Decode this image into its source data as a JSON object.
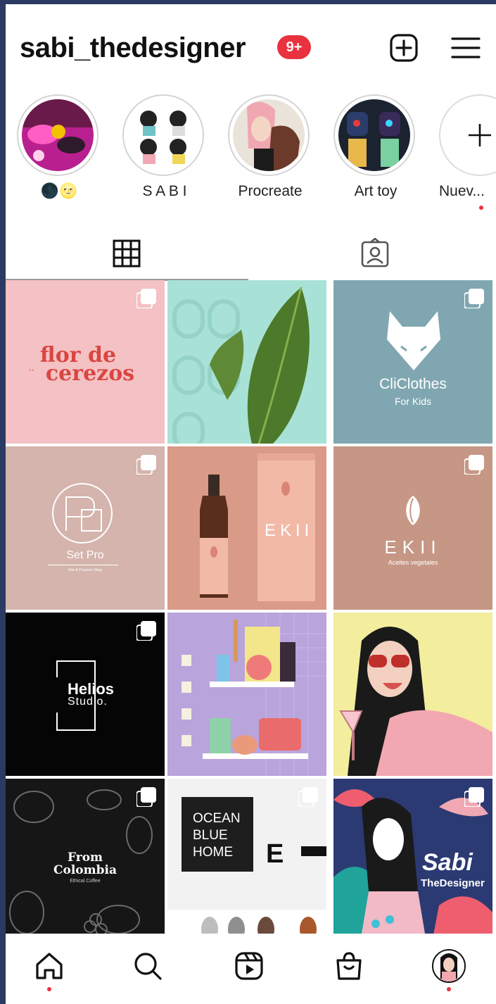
{
  "header": {
    "username": "sabi_thedesigner",
    "notification_badge": "9+",
    "icons": [
      "new-post-icon",
      "menu-icon"
    ]
  },
  "stories": [
    {
      "label": "🌑🌝",
      "thumb": "purple-art"
    },
    {
      "label": "S A B I",
      "thumb": "sketch-figures"
    },
    {
      "label": "Procreate",
      "thumb": "pink-hair-girl"
    },
    {
      "label": "Art toy",
      "thumb": "art-toy-figures"
    },
    {
      "label": "Nuev...",
      "thumb": "new-story-plus",
      "new_indicator": true
    }
  ],
  "tabs": {
    "active": "grid",
    "items": [
      "grid-icon",
      "tagged-icon"
    ]
  },
  "grid": {
    "posts": [
      {
        "name": "post-flor-de-cerezos",
        "line1": "flor de",
        "line2": "cerezos",
        "small": "• •",
        "bg": "#f4c1c4",
        "fg": "#d94641",
        "multi": true
      },
      {
        "name": "post-plant-leaf",
        "bg": "#a8e2d6",
        "multi": false
      },
      {
        "name": "post-cliclothes",
        "line1": "CliClothes",
        "line2": "For Kids",
        "bg": "#80a7b1",
        "fg": "#ffffff",
        "multi": true
      },
      {
        "name": "post-set-pro",
        "line1": "Set Pro",
        "line2": "Hair & Products Shop",
        "bg": "#d4b4ad",
        "fg": "#ffffff",
        "multi": true
      },
      {
        "name": "post-ekii-bottle",
        "line1": "EKII",
        "bg": "#d99a87",
        "fg": "#ffffff",
        "multi": false
      },
      {
        "name": "post-ekii-logo",
        "line1": "EKII",
        "line2": "Aceites vegetales",
        "bg": "#c69785",
        "fg": "#ffffff",
        "multi": true
      },
      {
        "name": "post-helios-studio",
        "line1": "Helios",
        "line2": "Studio.",
        "bg": "#050505",
        "fg": "#ffffff",
        "multi": true
      },
      {
        "name": "post-shelf-illustration",
        "bg": "#b9a4dc",
        "multi": false
      },
      {
        "name": "post-girl-drink",
        "bg": "#f3ed9e",
        "multi": false
      },
      {
        "name": "post-from-colombia",
        "line1": "From",
        "line2": "Colombia",
        "small": "Ethical Coffee",
        "bg": "#161616",
        "fg": "#ffffff",
        "multi": true
      },
      {
        "name": "post-ocean-blue-home",
        "line1": "OCEAN",
        "line2": "BLUE",
        "line3": "HOME",
        "mark": "E",
        "bg": "#f2f2f2",
        "fg": "#ffffff",
        "multi": true
      },
      {
        "name": "post-sabi-thedesigner",
        "line1": "Sabi",
        "line2": "TheDesigner",
        "bg": "#2b3a73",
        "fg": "#ffffff",
        "multi": true
      }
    ]
  },
  "bottom_nav": {
    "items": [
      "home-icon",
      "search-icon",
      "reels-icon",
      "shop-icon",
      "profile-avatar"
    ],
    "active": "home-icon"
  },
  "colors": {
    "accent_red": "#e8323f",
    "frame_blue": "#2b3a63"
  }
}
